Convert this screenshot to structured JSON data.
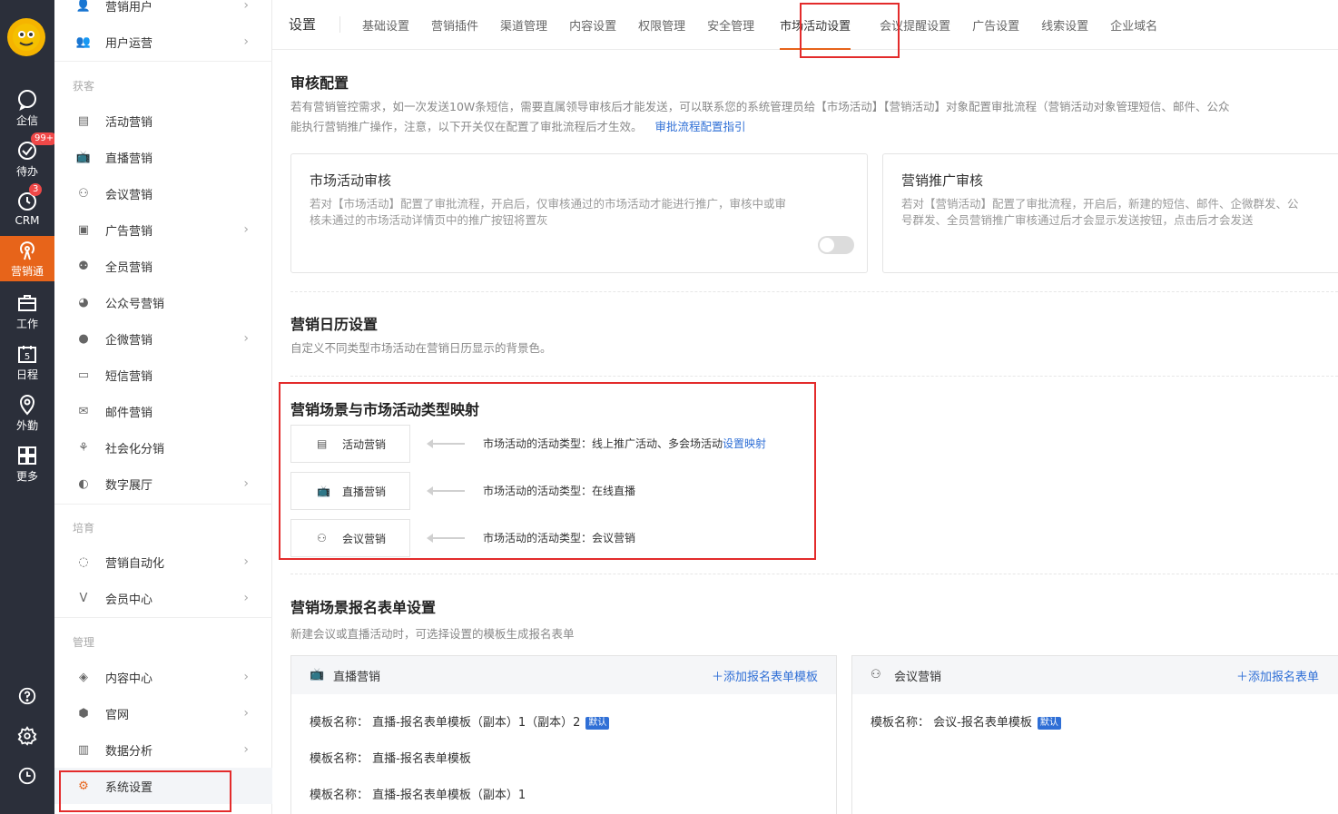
{
  "rail": {
    "items": [
      {
        "label": "企信",
        "icon": "chat-icon"
      },
      {
        "label": "待办",
        "icon": "check-circle-icon",
        "badge": "99+"
      },
      {
        "label": "CRM",
        "icon": "clock-icon",
        "badge": "3"
      },
      {
        "label": "营销通",
        "icon": "broadcast-icon"
      },
      {
        "label": "工作",
        "icon": "briefcase-icon"
      },
      {
        "label": "日程",
        "icon": "calendar-icon",
        "day": "5"
      },
      {
        "label": "外勤",
        "icon": "location-pin-icon"
      },
      {
        "label": "更多",
        "icon": "grid-icon"
      }
    ]
  },
  "sidebar": {
    "items": [
      {
        "label": "营销用户"
      },
      {
        "label": "用户运营"
      },
      {
        "group": "获客"
      },
      {
        "label": "活动营销"
      },
      {
        "label": "直播营销"
      },
      {
        "label": "会议营销"
      },
      {
        "label": "广告营销"
      },
      {
        "label": "全员营销"
      },
      {
        "label": "公众号营销"
      },
      {
        "label": "企微营销"
      },
      {
        "label": "短信营销"
      },
      {
        "label": "邮件营销"
      },
      {
        "label": "社会化分销"
      },
      {
        "label": "数字展厅"
      },
      {
        "group": "培育"
      },
      {
        "label": "营销自动化"
      },
      {
        "label": "会员中心"
      },
      {
        "group": "管理"
      },
      {
        "label": "内容中心"
      },
      {
        "label": "官网"
      },
      {
        "label": "数据分析"
      },
      {
        "label": "系统设置"
      }
    ]
  },
  "topbar": {
    "title": "设置",
    "tabs": [
      "基础设置",
      "营销插件",
      "渠道管理",
      "内容设置",
      "权限管理",
      "安全管理",
      "市场活动设置",
      "会议提醒设置",
      "广告设置",
      "线索设置",
      "企业域名"
    ]
  },
  "audit": {
    "title": "审核配置",
    "desc1": "若有营销管控需求，如一次发送10W条短信，需要直属领导审核后才能发送，可以联系您的系统管理员给【市场活动】【营销活动】对象配置审批流程（营销活动对象管理短信、邮件、公众",
    "desc2": "能执行营销推广操作，注意，以下开关仅在配置了审批流程后才生效。",
    "link": "审批流程配置指引",
    "card1_title": "市场活动审核",
    "card1_desc1": "若对【市场活动】配置了审批流程，开启后，仅审核通过的市场活动才能进行推广，审核中或审",
    "card1_desc2": "核未通过的市场活动详情页中的推广按钮将置灰",
    "card2_title": "营销推广审核",
    "card2_desc1": "若对【营销活动】配置了审批流程，开启后，新建的短信、邮件、企微群发、公",
    "card2_desc2": "号群发、全员营销推广审核通过后才会显示发送按钮，点击后才会发送"
  },
  "calendar": {
    "title": "营销日历设置",
    "desc": "自定义不同类型市场活动在营销日历显示的背景色。"
  },
  "mapping": {
    "title": "营销场景与市场活动类型映射",
    "rows": [
      {
        "label": "活动营销",
        "text": "市场活动的活动类型：线上推广活动、多会场活动",
        "link": "设置映射"
      },
      {
        "label": "直播营销",
        "text": "市场活动的活动类型：在线直播"
      },
      {
        "label": "会议营销",
        "text": "市场活动的活动类型：会议营销"
      }
    ]
  },
  "forms": {
    "title": "营销场景报名表单设置",
    "desc": "新建会议或直播活动时，可选择设置的模板生成报名表单",
    "live": {
      "title": "直播营销",
      "add": "添加报名表单模板",
      "rows": [
        {
          "text": "模板名称：  直播-报名表单模板（副本）1（副本）2",
          "tag": "默认"
        },
        {
          "text": "模板名称：  直播-报名表单模板"
        },
        {
          "text": "模板名称：  直播-报名表单模板（副本）1"
        }
      ]
    },
    "meeting": {
      "title": "会议营销",
      "add": "添加报名表单",
      "rows": [
        {
          "text": "模板名称：  会议-报名表单模板",
          "tag": "默认"
        }
      ]
    }
  }
}
